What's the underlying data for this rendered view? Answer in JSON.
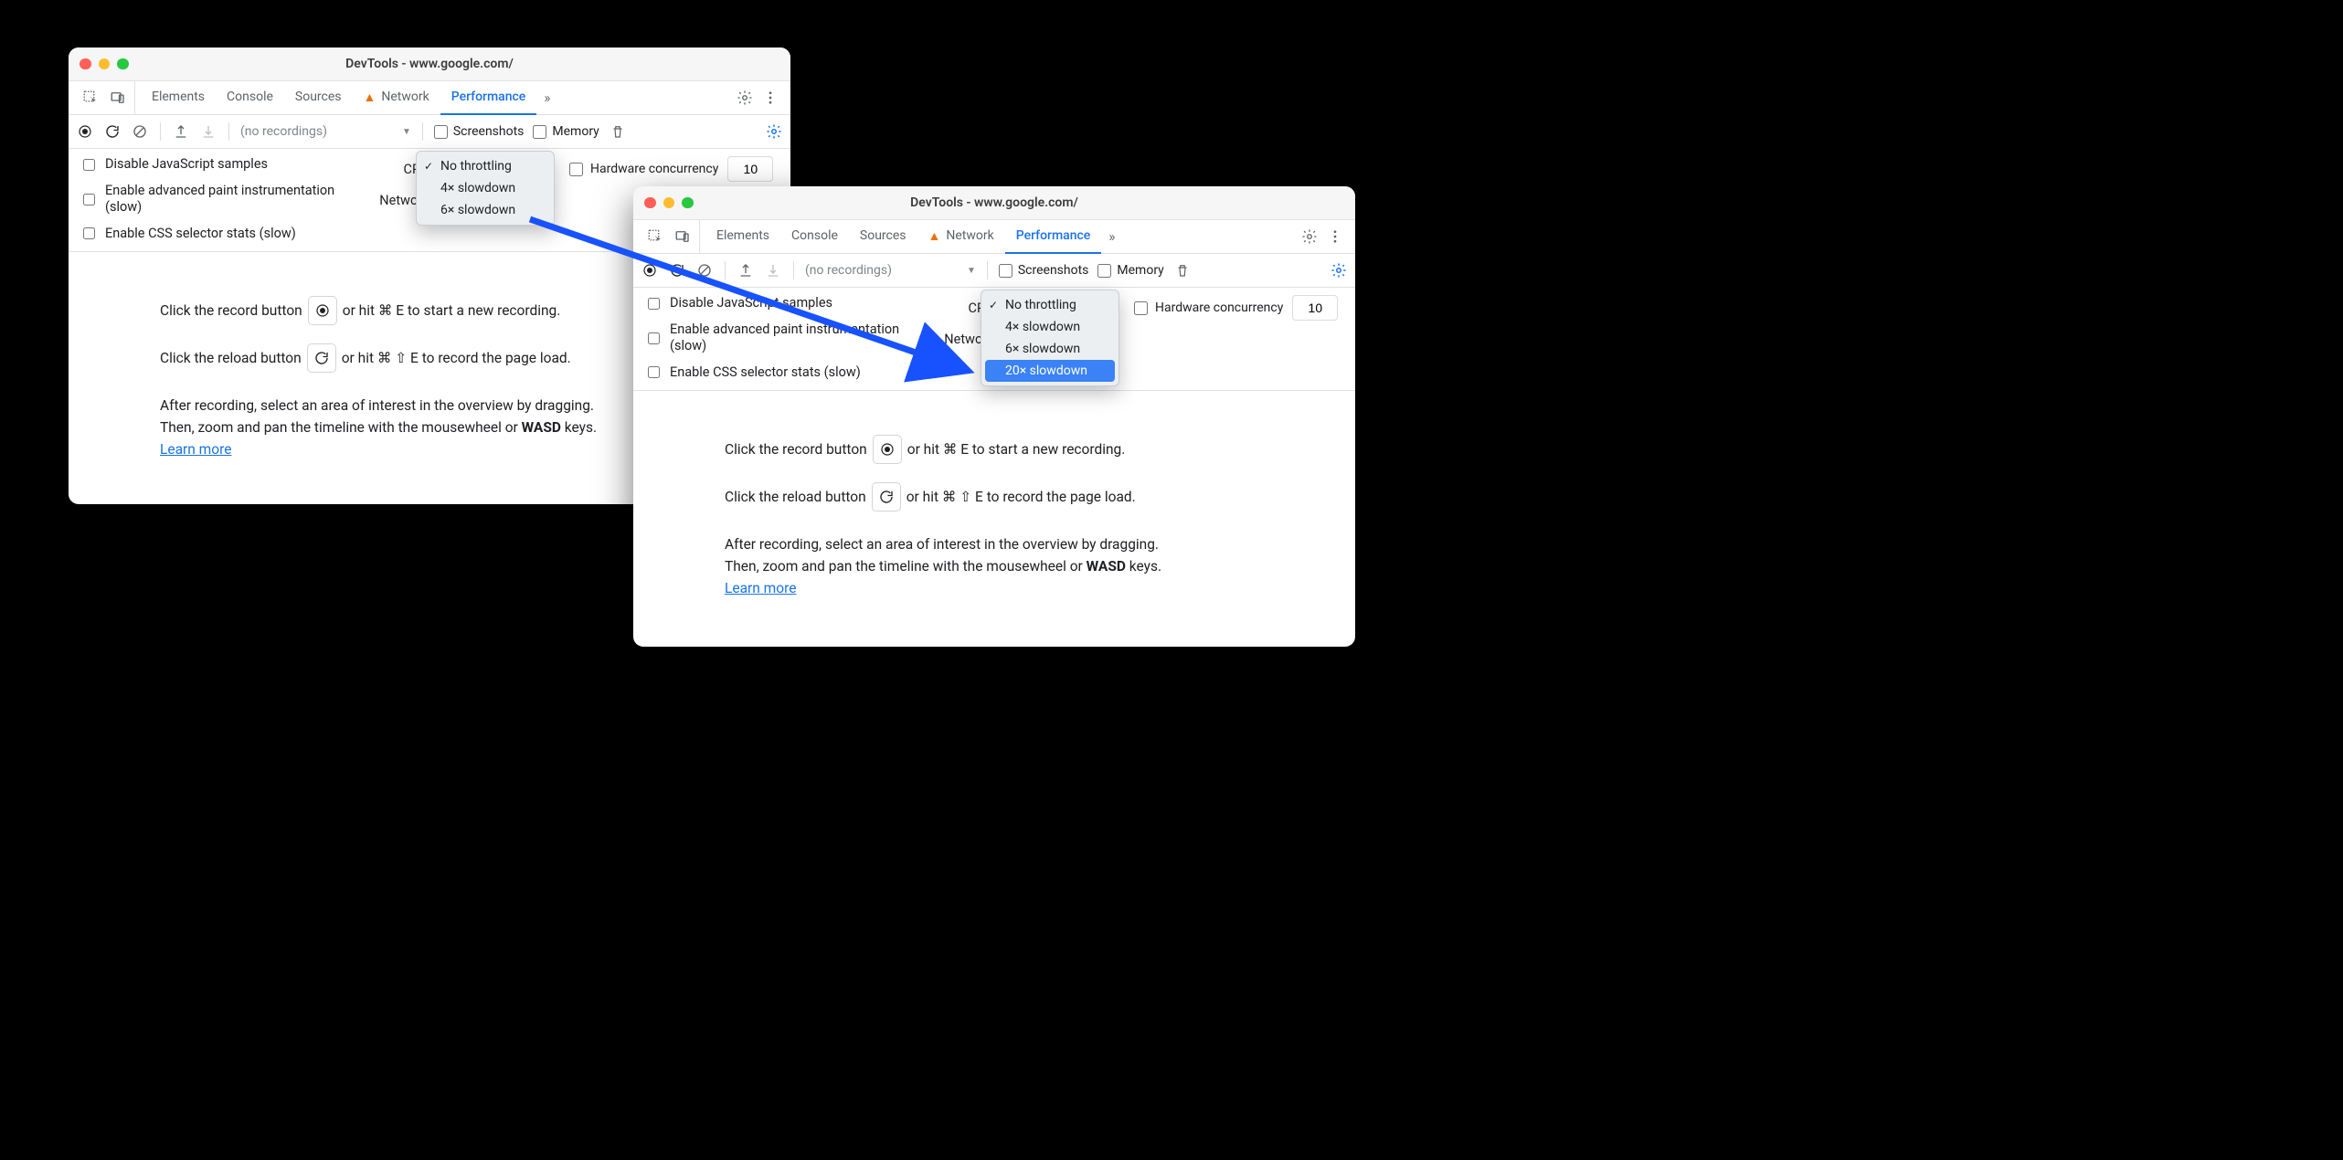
{
  "windows": [
    {
      "title": "DevTools - www.google.com/",
      "tabs": [
        "Elements",
        "Console",
        "Sources",
        "Network",
        "Performance"
      ],
      "activeTab": "Performance",
      "networkWarn": true,
      "recordingsSelect": "(no recordings)",
      "screenshotsLabel": "Screenshots",
      "memoryLabel": "Memory",
      "settings": {
        "disableJs": "Disable JavaScript samples",
        "advancedPaint": "Enable advanced paint instrumentation (slow)",
        "cssStats": "Enable CSS selector stats (slow)",
        "cpuLabel": "CPU:",
        "networkLabel": "Network:",
        "hwLabel": "Hardware concurrency",
        "hwValue": "10"
      },
      "cpuOptions": [
        "No throttling",
        "4× slowdown",
        "6× slowdown"
      ],
      "cpuSelected": "No throttling",
      "hints": {
        "recordPre": "Click the record button",
        "recordPost": "or hit ⌘ E to start a new recording.",
        "reloadPre": "Click the reload button",
        "reloadPost": "or hit ⌘ ⇧ E to record the page load.",
        "after1": "After recording, select an area of interest in the overview by dragging.",
        "after2_a": "Then, zoom and pan the timeline with the mousewheel or ",
        "after2_b": "WASD",
        "after2_c": " keys.",
        "learn": "Learn more"
      }
    },
    {
      "title": "DevTools - www.google.com/",
      "tabs": [
        "Elements",
        "Console",
        "Sources",
        "Network",
        "Performance"
      ],
      "activeTab": "Performance",
      "networkWarn": true,
      "recordingsSelect": "(no recordings)",
      "screenshotsLabel": "Screenshots",
      "memoryLabel": "Memory",
      "settings": {
        "disableJs": "Disable JavaScript samples",
        "advancedPaint": "Enable advanced paint instrumentation (slow)",
        "cssStats": "Enable CSS selector stats (slow)",
        "cpuLabel": "CPU:",
        "networkLabel": "Network:",
        "hwLabel": "Hardware concurrency",
        "hwValue": "10"
      },
      "cpuOptions": [
        "No throttling",
        "4× slowdown",
        "6× slowdown",
        "20× slowdown"
      ],
      "cpuSelected": "No throttling",
      "cpuHighlighted": "20× slowdown",
      "hints": {
        "recordPre": "Click the record button",
        "recordPost": "or hit ⌘ E to start a new recording.",
        "reloadPre": "Click the reload button",
        "reloadPost": "or hit ⌘ ⇧ E to record the page load.",
        "after1": "After recording, select an area of interest in the overview by dragging.",
        "after2_a": "Then, zoom and pan the timeline with the mousewheel or ",
        "after2_b": "WASD",
        "after2_c": " keys.",
        "learn": "Learn more"
      }
    }
  ]
}
